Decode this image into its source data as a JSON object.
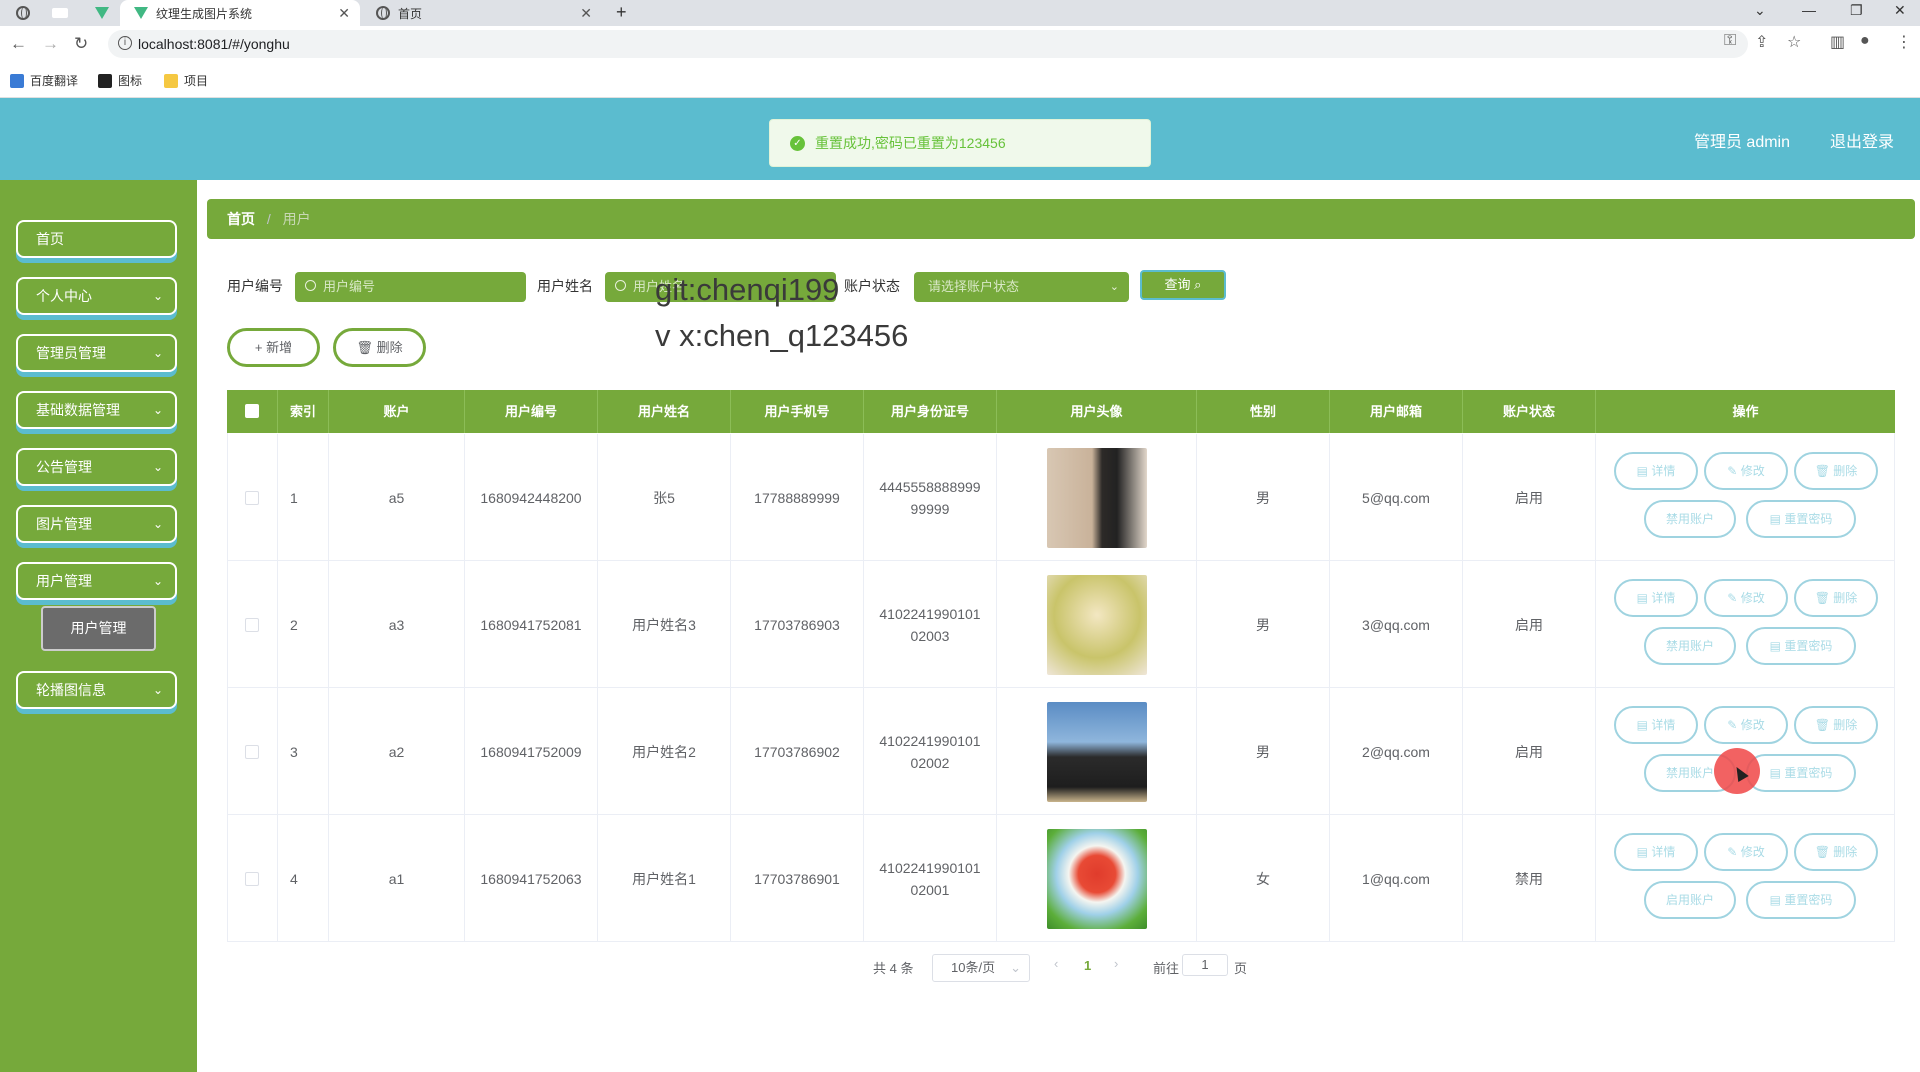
{
  "browser": {
    "tabs": [
      {
        "title": "纹理生成图片系统",
        "close": "✕"
      },
      {
        "title": "首页",
        "close": "✕"
      }
    ],
    "new_tab": "+",
    "url": "localhost:8081/#/yonghu",
    "bookmarks": [
      "百度翻译",
      "图标",
      "项目"
    ]
  },
  "toast": {
    "message": "重置成功,密码已重置为123456"
  },
  "header": {
    "user": "管理员 admin",
    "logout": "退出登录"
  },
  "sidebar": {
    "items": [
      "首页",
      "个人中心",
      "管理员管理",
      "基础数据管理",
      "公告管理",
      "图片管理",
      "用户管理",
      "轮播图信息"
    ],
    "active_sub": "用户管理"
  },
  "breadcrumb": {
    "home": "首页",
    "sep": "/",
    "current": "用户"
  },
  "filters": {
    "user_no_label": "用户编号",
    "user_no_placeholder": "用户编号",
    "user_name_label": "用户姓名",
    "user_name_placeholder": "用户姓名",
    "status_label": "账户状态",
    "status_placeholder": "请选择账户状态",
    "query": "查询"
  },
  "actions": {
    "add": "+ 新增",
    "delete": "删除"
  },
  "watermark": {
    "line1": "git:chenqi199",
    "line2": "v x:chen_q123456"
  },
  "table": {
    "columns": [
      "索引",
      "账户",
      "用户编号",
      "用户姓名",
      "用户手机号",
      "用户身份证号",
      "用户头像",
      "性别",
      "用户邮箱",
      "账户状态",
      "操作"
    ],
    "rows": [
      {
        "index": "1",
        "account": "a5",
        "no": "1680942448200",
        "name": "张5",
        "phone": "17788889999",
        "id1": "4445558888999",
        "id2": "99999",
        "gender": "男",
        "email": "5@qq.com",
        "status": "启用",
        "toggle": "禁用账户"
      },
      {
        "index": "2",
        "account": "a3",
        "no": "1680941752081",
        "name": "用户姓名3",
        "phone": "17703786903",
        "id1": "4102241990101",
        "id2": "02003",
        "gender": "男",
        "email": "3@qq.com",
        "status": "启用",
        "toggle": "禁用账户"
      },
      {
        "index": "3",
        "account": "a2",
        "no": "1680941752009",
        "name": "用户姓名2",
        "phone": "17703786902",
        "id1": "4102241990101",
        "id2": "02002",
        "gender": "男",
        "email": "2@qq.com",
        "status": "启用",
        "toggle": "禁用账户"
      },
      {
        "index": "4",
        "account": "a1",
        "no": "1680941752063",
        "name": "用户姓名1",
        "phone": "17703786901",
        "id1": "4102241990101",
        "id2": "02001",
        "gender": "女",
        "email": "1@qq.com",
        "status": "禁用",
        "toggle": "启用账户"
      }
    ],
    "row_actions": {
      "detail": "详情",
      "edit": "修改",
      "delete": "删除",
      "reset": "重置密码"
    }
  },
  "pagination": {
    "total": "共 4 条",
    "page_size": "10条/页",
    "current": "1",
    "goto_label": "前往",
    "goto_value": "1",
    "page_suffix": "页"
  }
}
